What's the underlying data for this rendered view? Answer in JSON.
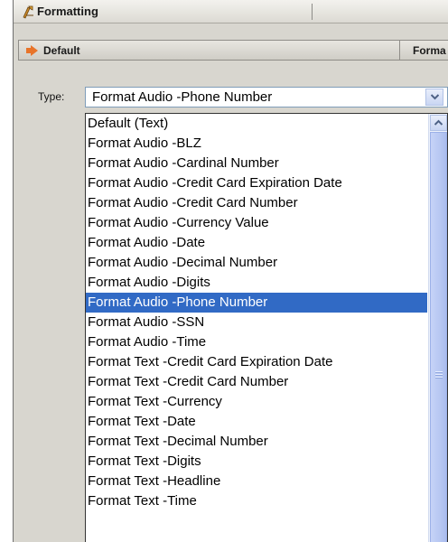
{
  "panel": {
    "title": "Formatting",
    "icon": "formatting-tools-icon"
  },
  "tabs": {
    "active_label": "Default",
    "next_label": "Forma"
  },
  "type_field": {
    "label": "Type:",
    "value": "Format Audio -Phone Number"
  },
  "dropdown": {
    "selected_index": 9,
    "items": [
      {
        "label": "Default (Text)"
      },
      {
        "label": "Format Audio -BLZ"
      },
      {
        "label": "Format Audio -Cardinal Number"
      },
      {
        "label": "Format Audio -Credit Card Expiration Date"
      },
      {
        "label": "Format Audio -Credit Card Number"
      },
      {
        "label": "Format Audio -Currency Value"
      },
      {
        "label": "Format Audio -Date"
      },
      {
        "label": "Format Audio -Decimal Number"
      },
      {
        "label": "Format Audio -Digits"
      },
      {
        "label": "Format Audio -Phone Number"
      },
      {
        "label": "Format Audio -SSN"
      },
      {
        "label": "Format Audio -Time"
      },
      {
        "label": "Format Text -Credit Card Expiration Date"
      },
      {
        "label": "Format Text -Credit Card Number"
      },
      {
        "label": "Format Text -Currency"
      },
      {
        "label": "Format Text -Date"
      },
      {
        "label": "Format Text -Decimal Number"
      },
      {
        "label": "Format Text -Digits"
      },
      {
        "label": "Format Text -Headline"
      },
      {
        "label": "Format Text -Time"
      }
    ]
  },
  "colors": {
    "selection": "#316ac5",
    "tab_arrow": "#e8742a",
    "panel_bg": "#d8d6cf"
  }
}
